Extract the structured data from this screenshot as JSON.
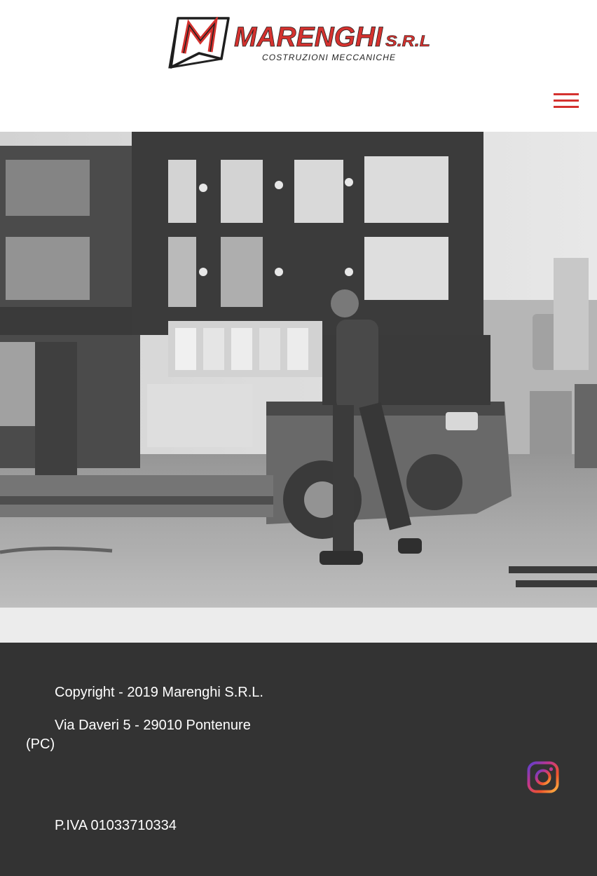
{
  "header": {
    "logo": {
      "mark": "M",
      "name": "MARENGHI",
      "suffix": "S.R.L",
      "tagline": "COSTRUZIONI  MECCANICHE"
    },
    "menu_icon": "hamburger-menu-icon"
  },
  "hero": {
    "image": "black-and-white photo of a worker walking past a flatbed trailer loaded with steel frames in a workshop"
  },
  "footer": {
    "copyright": "Copyright - 2019 Marenghi S.R.L.",
    "address": "Via Daveri 5 - 29010 Pontenure (PC)",
    "vat": "P.IVA 01033710334",
    "social_icon": "instagram-icon"
  },
  "colors": {
    "brand_red": "#d4322f",
    "footer_bg": "#333333",
    "separator_bg": "#ececec"
  }
}
